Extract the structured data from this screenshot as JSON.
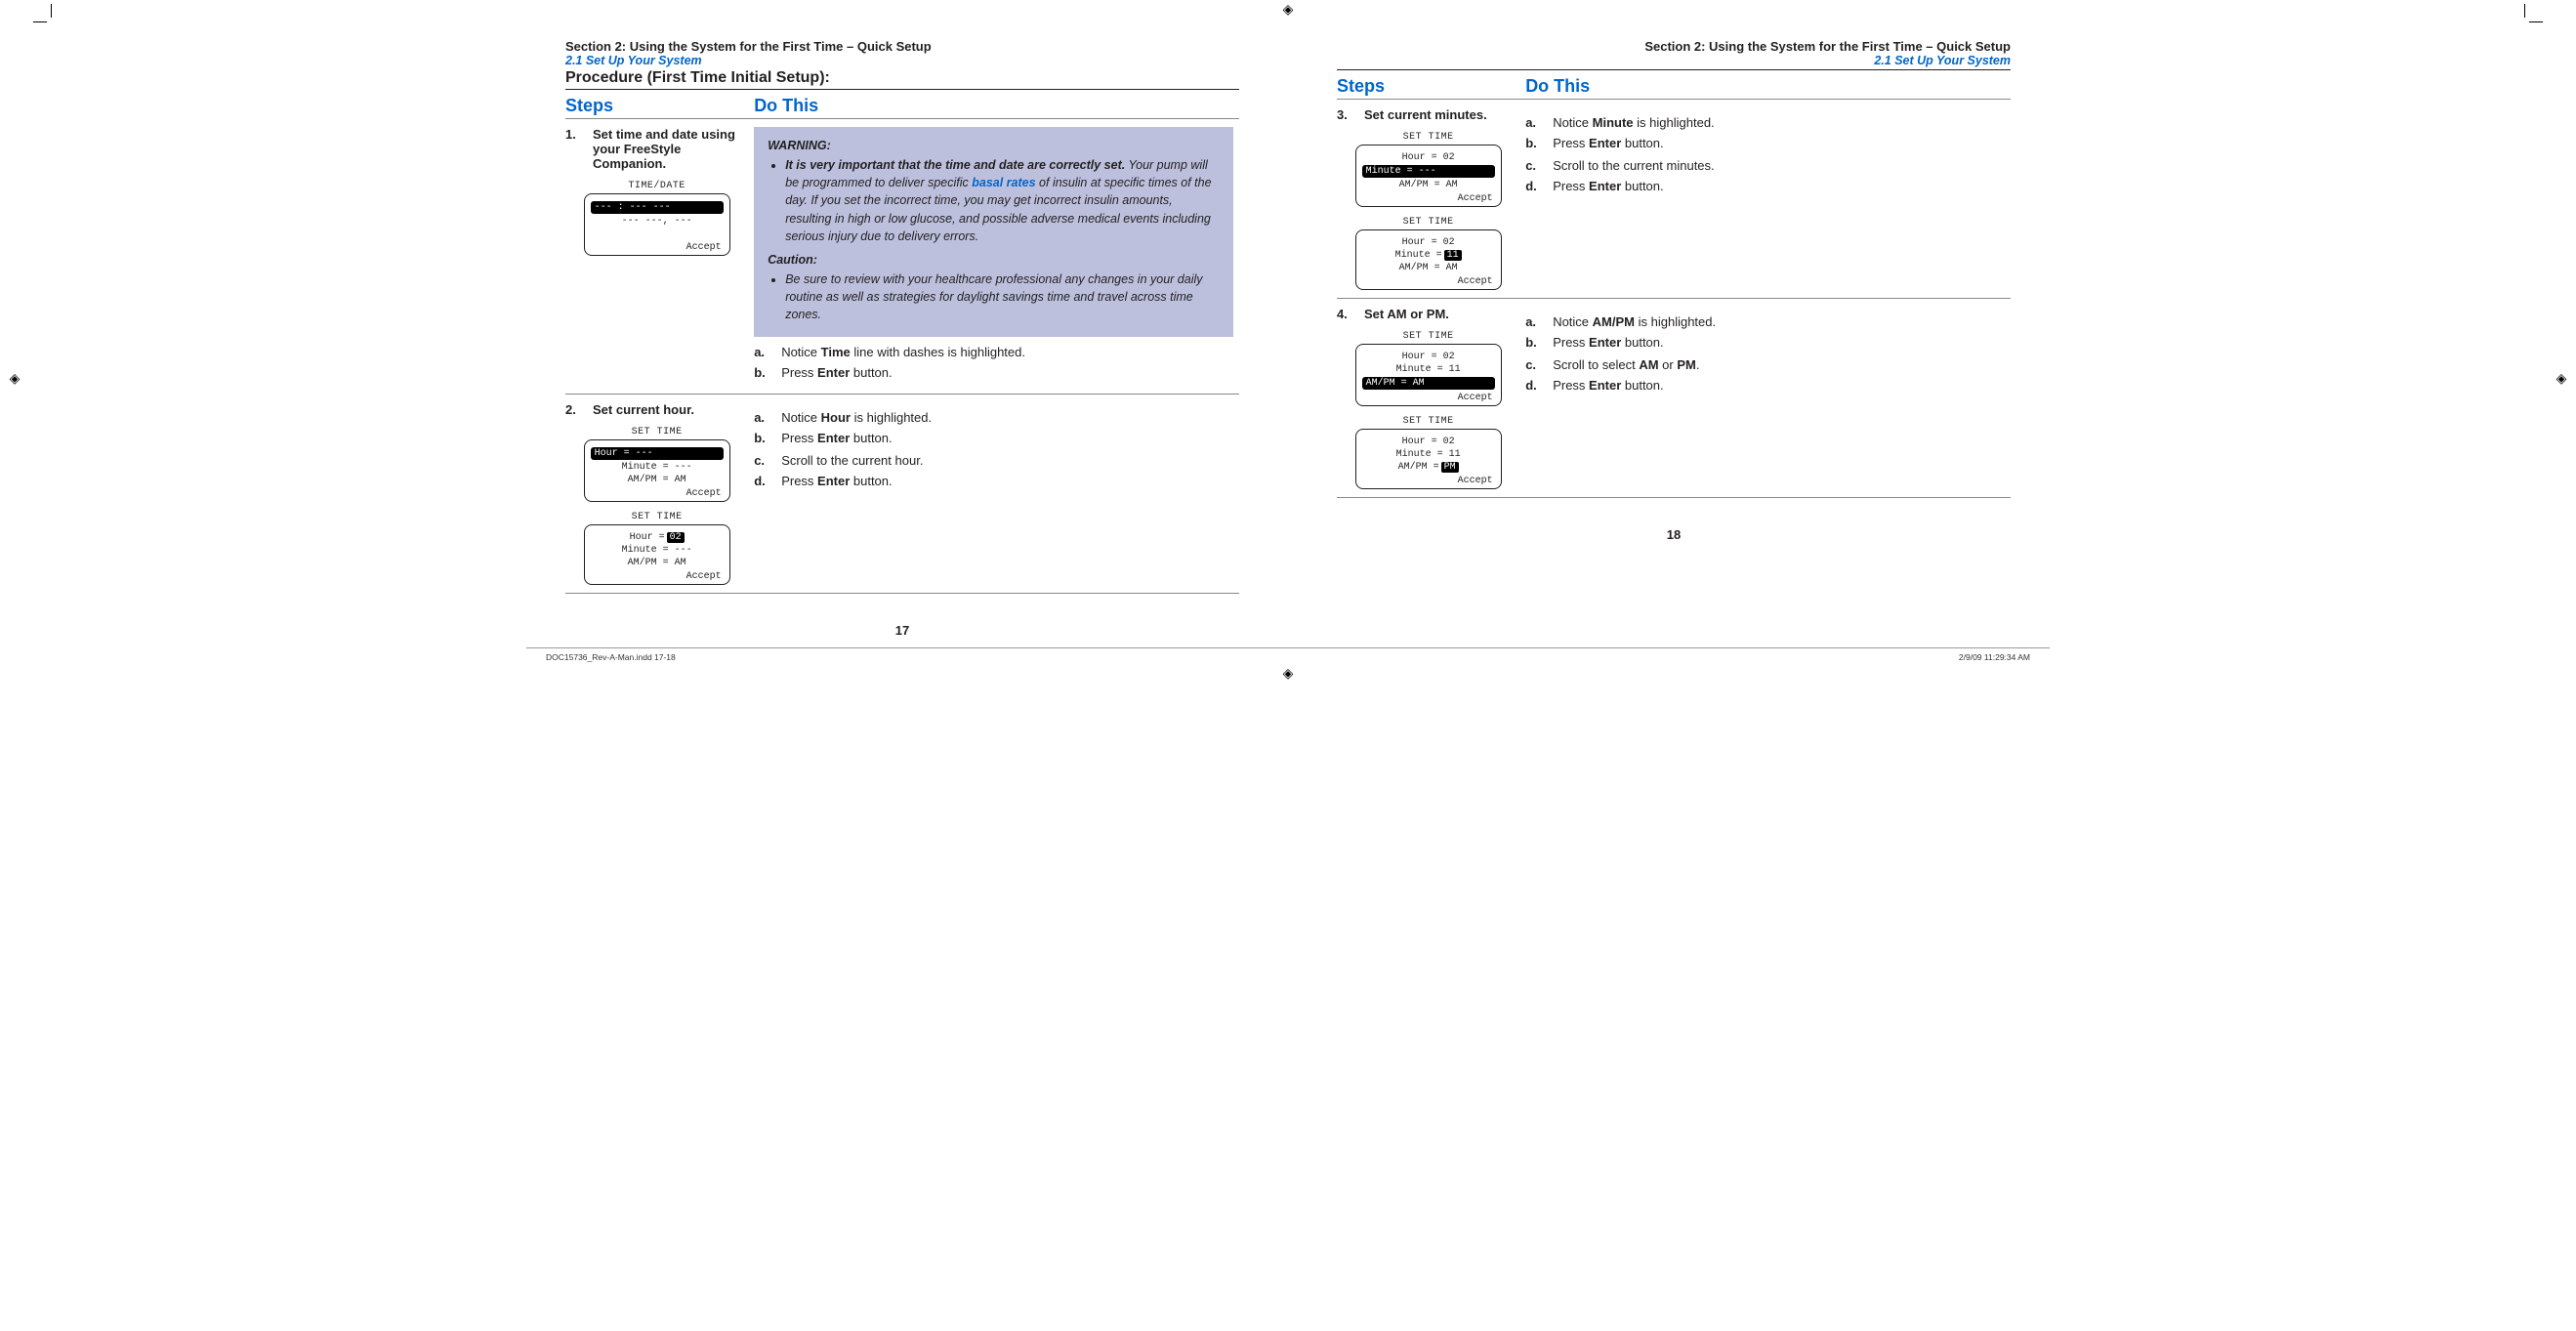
{
  "header": {
    "section": "Section 2: Using the System for the First Time – Quick Setup",
    "subsection": "2.1 Set Up Your System",
    "procedure": "Procedure (First Time Initial Setup):"
  },
  "columns": {
    "steps": "Steps",
    "dothis": "Do This"
  },
  "left": {
    "step1": {
      "num": "1.",
      "text": "Set time and date using your FreeStyle Companion.",
      "screen_title": "TIME/DATE",
      "screen_hl": "--- : ---  ---",
      "screen_line": "--- ---, ---",
      "accept": "Accept",
      "warn_head": "WARNING:",
      "warn_bold": "It is very important that the time and date are correctly set.",
      "warn_rest": " Your pump will be programmed to deliver specific ",
      "warn_link": "basal rates",
      "warn_rest2": " of insulin at specific times of the day. If you set the incorrect time, you may get incorrect insulin amounts, resulting in high or low glucose, and possible adverse medical events including serious injury due to delivery errors.",
      "caut_head": "Caution:",
      "caut_text": "Be sure to review with your healthcare professional any changes in your daily routine as well as strategies for daylight savings time and travel across time zones.",
      "a_pre": "Notice ",
      "a_b": "Time",
      "a_post": " line with dashes is highlighted.",
      "b_pre": "Press ",
      "b_b": "Enter",
      "b_post": " button."
    },
    "step2": {
      "num": "2.",
      "text": "Set current hour.",
      "scr1_title": "SET TIME",
      "scr1_hl": "Hour = ---",
      "scr1_l2": "Minute = ---",
      "scr1_l3": "AM/PM = AM",
      "scr2_title": "SET TIME",
      "scr2_l1_pre": "Hour = ",
      "scr2_l1_chip": "02",
      "scr2_l2": "Minute = ---",
      "scr2_l3": "AM/PM = AM",
      "accept": "Accept",
      "a_pre": "Notice ",
      "a_b": "Hour",
      "a_post": " is highlighted.",
      "b_pre": "Press ",
      "b_b": "Enter",
      "b_post": " button.",
      "c": "Scroll to the current hour.",
      "d_pre": "Press ",
      "d_b": "Enter",
      "d_post": " button."
    },
    "pagenum": "17"
  },
  "right": {
    "step3": {
      "num": "3.",
      "text": "Set current minutes.",
      "scr1_title": "SET TIME",
      "scr1_l1": "Hour = 02",
      "scr1_hl": "Minute = ---",
      "scr1_l3": "AM/PM = AM",
      "scr2_title": "SET TIME",
      "scr2_l1": "Hour = 02",
      "scr2_l2_pre": "Minute = ",
      "scr2_l2_chip": "11",
      "scr2_l3": "AM/PM = AM",
      "accept": "Accept",
      "a_pre": "Notice ",
      "a_b": "Minute",
      "a_post": " is highlighted.",
      "b_pre": "Press ",
      "b_b": "Enter",
      "b_post": " button.",
      "c": "Scroll to the current minutes.",
      "d_pre": "Press ",
      "d_b": "Enter",
      "d_post": " button."
    },
    "step4": {
      "num": "4.",
      "text": "Set AM or PM.",
      "scr1_title": "SET TIME",
      "scr1_l1": "Hour = 02",
      "scr1_l2": "Minute = 11",
      "scr1_hl": "AM/PM = AM",
      "scr2_title": "SET TIME",
      "scr2_l1": "Hour = 02",
      "scr2_l2": "Minute = 11",
      "scr2_l3_pre": "AM/PM = ",
      "scr2_l3_chip": "PM",
      "accept": "Accept",
      "a_pre": "Notice ",
      "a_b": "AM/PM",
      "a_post": " is highlighted.",
      "b_pre": "Press ",
      "b_b": "Enter",
      "b_post": " button.",
      "c_pre": "Scroll to select ",
      "c_b1": "AM",
      "c_mid": " or ",
      "c_b2": "PM",
      "c_post": ".",
      "d_pre": "Press ",
      "d_b": "Enter",
      "d_post": " button."
    },
    "pagenum": "18"
  },
  "footer": {
    "left": "DOC15736_Rev-A-Man.indd   17-18",
    "right": "2/9/09   11:29:34 AM"
  },
  "letters": {
    "a": "a.",
    "b": "b.",
    "c": "c.",
    "d": "d."
  },
  "reg_glyph": "◈"
}
